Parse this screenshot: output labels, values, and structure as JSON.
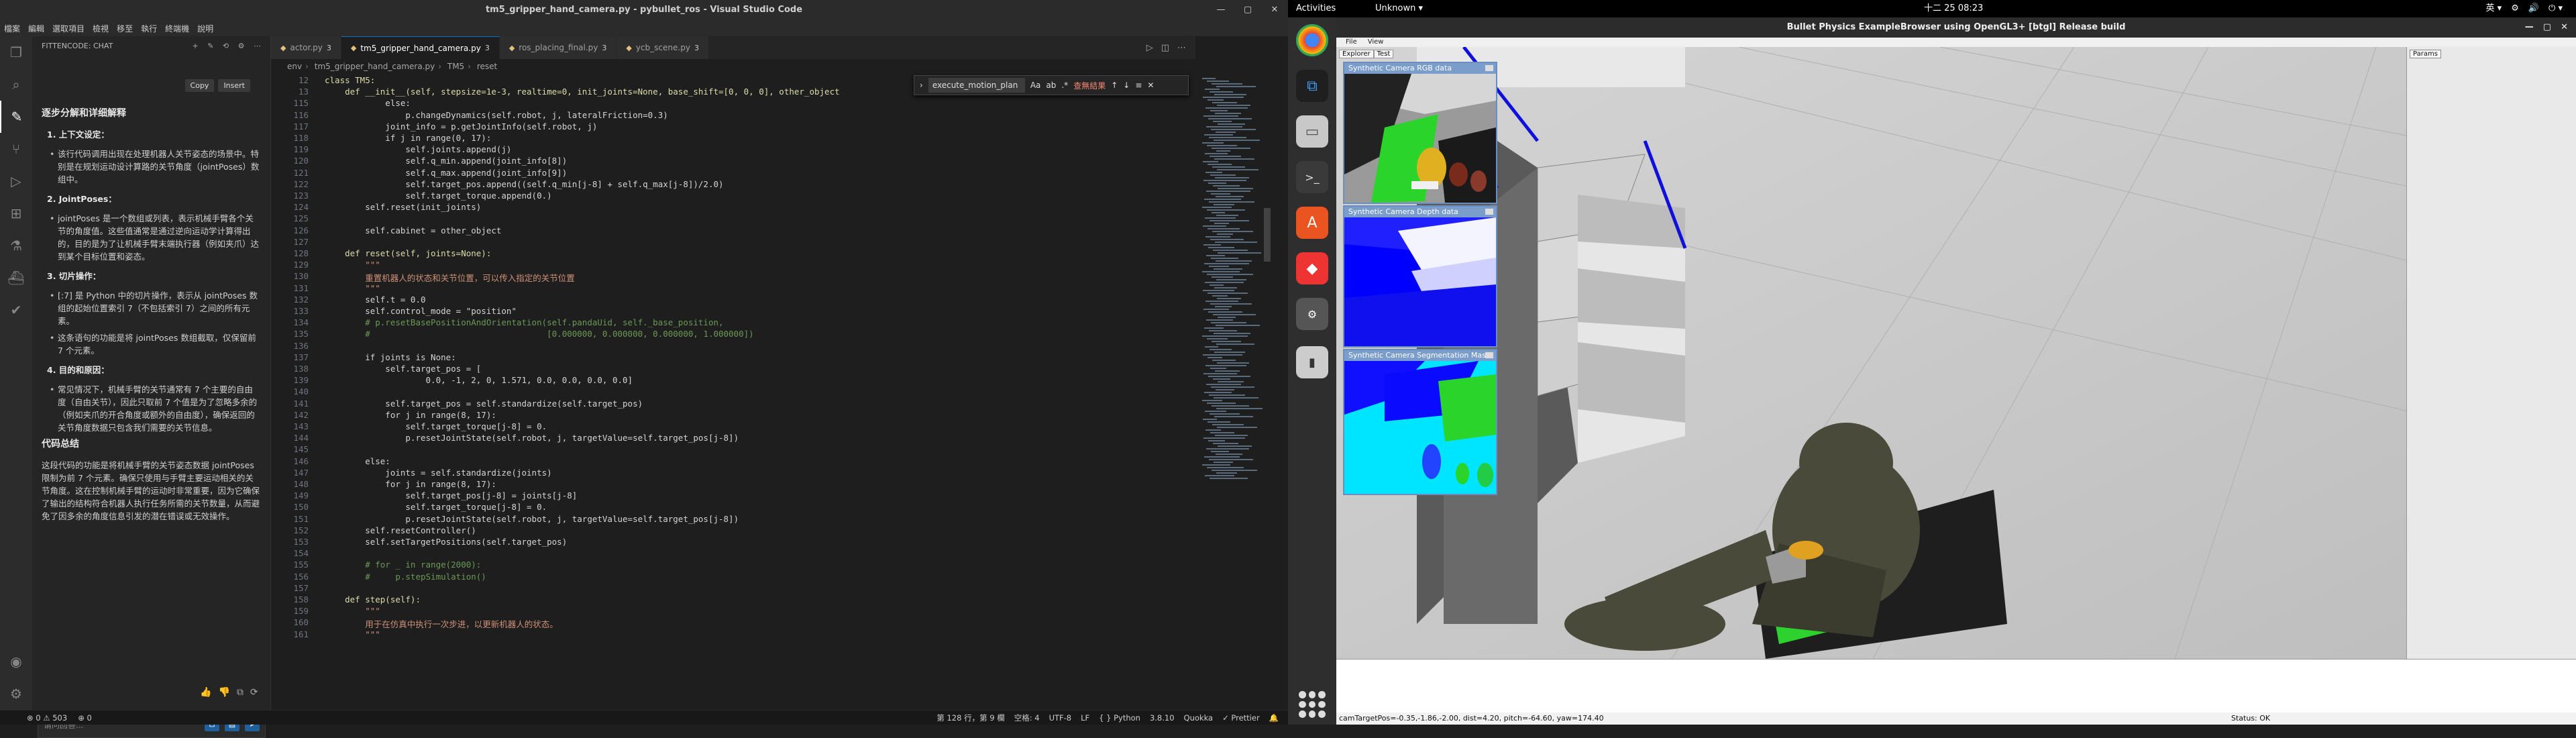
{
  "vscode": {
    "title": "tm5_gripper_hand_camera.py - pybullet_ros - Visual Studio Code",
    "menu": [
      "檔案",
      "編輯",
      "選取項目",
      "檢視",
      "移至",
      "執行",
      "終端機",
      "說明"
    ],
    "sidebar_title": "FITTENCODE: CHAT",
    "side_actions": [
      "Copy",
      "Insert"
    ],
    "chat": {
      "heading": "逐步分解和详细解释",
      "s1": "1. 上下文设定：",
      "s1b": "该行代码调用出现在处理机器人关节姿态的场景中。特别是在规划运动设计算路的关节角度（jointPoses）数组中。",
      "s2": "2. JointPoses：",
      "s2b": "jointPoses 是一个数组或列表，表示机械手臂各个关节的角度值。这些值通常是通过逆向运动学计算得出的，目的是为了让机械手臂末端执行器（例如夹爪）达到某个目标位置和姿态。",
      "s3": "3. 切片操作：",
      "s3b1": "[:7] 是 Python 中的切片操作，表示从 jointPoses 数组的起始位置索引 7（不包括索引 7）之间的所有元素。",
      "s3b2": "这条语句的功能是将 jointPoses 数组截取，仅保留前 7 个元素。",
      "s4": "4. 目的和原因：",
      "s4b": "常见情况下，机械手臂的关节通常有 7 个主要的自由度（自由关节），因此只取前 7 个值是为了忽略多余的（例如夹爪的开合角度或额外的自由度），确保返回的关节角度数据只包含我们需要的关节信息。",
      "summary_title": "代码总结",
      "summary": "这段代码的功能是将机械手臂的关节姿态数据 jointPoses 限制为前 7 个元素。确保只使用与手臂主要运动相关的关节角度。这在控制机械手臂的运动时非常重要，因为它确保了输出的结构符合机器人执行任务所需的关节数量，从而避免了因多余的角度信息引发的潜在错误或无效操作。",
      "input_placeholder": "请问回答..."
    },
    "tabs": [
      {
        "label": "actor.py",
        "mod": "3"
      },
      {
        "label": "tm5_gripper_hand_camera.py",
        "mod": "3"
      },
      {
        "label": "ros_placing_final.py",
        "mod": "3"
      },
      {
        "label": "ycb_scene.py",
        "mod": "3"
      }
    ],
    "breadcrumb": [
      "env",
      "tm5_gripper_hand_camera.py",
      "TM5",
      "reset"
    ],
    "find": {
      "query": "execute_motion_plan",
      "result": "查無結果"
    },
    "lines": [
      {
        "n": "12",
        "t": "class TM5:"
      },
      {
        "n": "13",
        "t": "    def __init__(self, stepsize=1e-3, realtime=0, init_joints=None, base_shift=[0, 0, 0], other_object"
      },
      {
        "n": "115",
        "t": "            else:"
      },
      {
        "n": "116",
        "t": "                p.changeDynamics(self.robot, j, lateralFriction=0.3)"
      },
      {
        "n": "117",
        "t": "            joint_info = p.getJointInfo(self.robot, j)"
      },
      {
        "n": "118",
        "t": "            if j in range(0, 17):"
      },
      {
        "n": "119",
        "t": "                self.joints.append(j)"
      },
      {
        "n": "120",
        "t": "                self.q_min.append(joint_info[8])"
      },
      {
        "n": "121",
        "t": "                self.q_max.append(joint_info[9])"
      },
      {
        "n": "122",
        "t": "                self.target_pos.append((self.q_min[j-8] + self.q_max[j-8])/2.0)"
      },
      {
        "n": "123",
        "t": "                self.target_torque.append(0.)"
      },
      {
        "n": "124",
        "t": "        self.reset(init_joints)"
      },
      {
        "n": "125",
        "t": ""
      },
      {
        "n": "126",
        "t": "        self.cabinet = other_object"
      },
      {
        "n": "127",
        "t": ""
      },
      {
        "n": "128",
        "t": "    def reset(self, joints=None):"
      },
      {
        "n": "129",
        "t": "        \"\"\""
      },
      {
        "n": "130",
        "t": "        重置机器人的状态和关节位置，可以传入指定的关节位置"
      },
      {
        "n": "131",
        "t": "        \"\"\""
      },
      {
        "n": "132",
        "t": "        self.t = 0.0"
      },
      {
        "n": "133",
        "t": "        self.control_mode = \"position\""
      },
      {
        "n": "134",
        "t": "        # p.resetBasePositionAndOrientation(self.pandaUid, self._base_position,"
      },
      {
        "n": "135",
        "t": "        #                                   [0.000000, 0.000000, 0.000000, 1.000000])"
      },
      {
        "n": "136",
        "t": ""
      },
      {
        "n": "137",
        "t": "        if joints is None:"
      },
      {
        "n": "138",
        "t": "            self.target_pos = ["
      },
      {
        "n": "139",
        "t": "                    0.0, -1, 2, 0, 1.571, 0.0, 0.0, 0.0, 0.0]"
      },
      {
        "n": "140",
        "t": ""
      },
      {
        "n": "141",
        "t": "            self.target_pos = self.standardize(self.target_pos)"
      },
      {
        "n": "142",
        "t": "            for j in range(8, 17):"
      },
      {
        "n": "143",
        "t": "                self.target_torque[j-8] = 0."
      },
      {
        "n": "144",
        "t": "                p.resetJointState(self.robot, j, targetValue=self.target_pos[j-8])"
      },
      {
        "n": "145",
        "t": ""
      },
      {
        "n": "146",
        "t": "        else:"
      },
      {
        "n": "147",
        "t": "            joints = self.standardize(joints)"
      },
      {
        "n": "148",
        "t": "            for j in range(8, 17):"
      },
      {
        "n": "149",
        "t": "                self.target_pos[j-8] = joints[j-8]"
      },
      {
        "n": "150",
        "t": "                self.target_torque[j-8] = 0."
      },
      {
        "n": "151",
        "t": "                p.resetJointState(self.robot, j, targetValue=self.target_pos[j-8])"
      },
      {
        "n": "152",
        "t": "        self.resetController()"
      },
      {
        "n": "153",
        "t": "        self.setTargetPositions(self.target_pos)"
      },
      {
        "n": "154",
        "t": ""
      },
      {
        "n": "155",
        "t": "        # for _ in range(2000):"
      },
      {
        "n": "156",
        "t": "        #     p.stepSimulation()"
      },
      {
        "n": "157",
        "t": ""
      },
      {
        "n": "158",
        "t": "    def step(self):"
      },
      {
        "n": "159",
        "t": "        \"\"\""
      },
      {
        "n": "160",
        "t": "        用于在仿真中执行一次步进，以更新机器人的状态。"
      },
      {
        "n": "161",
        "t": "        \"\"\""
      }
    ],
    "status_left": [
      "⊗ 0 ⚠ 503",
      "⊕ 0"
    ],
    "status_right": [
      "第 128 行，第 9 欄",
      "空格: 4",
      "UTF-8",
      "LF",
      "{ } Python",
      "3.8.10",
      "Quokka",
      "✓ Prettier"
    ]
  },
  "topbar": {
    "activities": "Activities",
    "app": "Unknown ▾",
    "clock": "十二 25  08:23",
    "tray": [
      "英 ▾",
      "⚙",
      "🔊",
      "⏻ ▾"
    ]
  },
  "bullet": {
    "title": "Bullet Physics ExampleBrowser using OpenGL3+ [btgl] Release build",
    "menu": [
      "File",
      "View"
    ],
    "explorer_tabs": [
      "Explorer",
      "Test"
    ],
    "params_tab": "Params",
    "cams": [
      "Synthetic Camera RGB data",
      "Synthetic Camera Depth data",
      "Synthetic Camera Segmentation Mask"
    ],
    "status_left": "camTargetPos=-0.35,-1.86,-2.00, dist=4.20, pitch=-64.60, yaw=174.40",
    "status_right": "Status: OK"
  }
}
